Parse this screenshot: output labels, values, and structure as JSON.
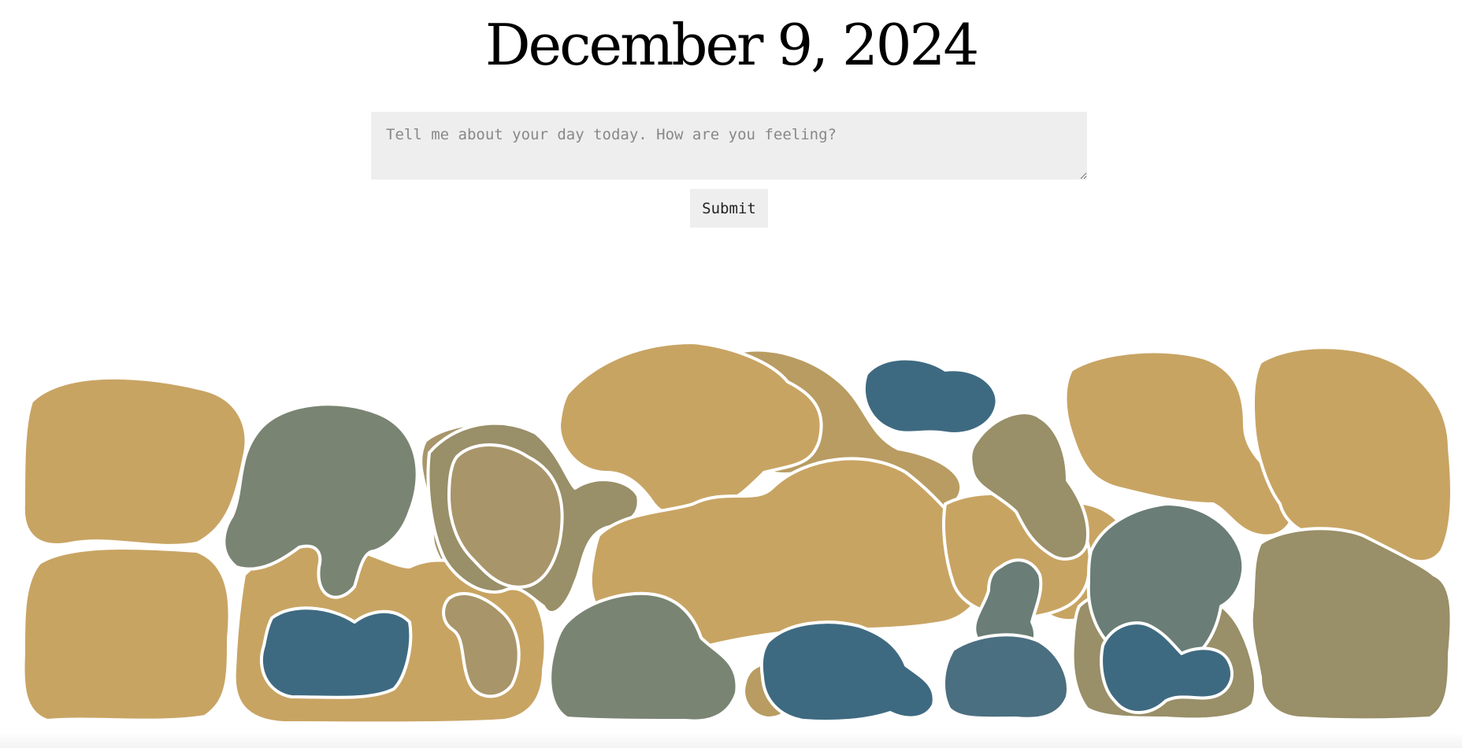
{
  "header": {
    "date": "December 9, 2024"
  },
  "journal": {
    "placeholder": "Tell me about your day today. How are you feeling?",
    "value": "",
    "submit_label": "Submit"
  },
  "mood_blobs": {
    "palette": {
      "gold": "#c8a463",
      "tan": "#b89c62",
      "olive": "#998f68",
      "khaki": "#a8956a",
      "sage": "#7a8473",
      "slate-green": "#6a7d76",
      "teal-blue": "#3e6a81",
      "steel-blue": "#4a6f80"
    },
    "entries": [
      {
        "color": "gold"
      },
      {
        "color": "gold"
      },
      {
        "color": "sage"
      },
      {
        "color": "gold"
      },
      {
        "color": "teal-blue"
      },
      {
        "color": "olive"
      },
      {
        "color": "khaki"
      },
      {
        "color": "gold"
      },
      {
        "color": "tan"
      },
      {
        "color": "gold"
      },
      {
        "color": "sage"
      },
      {
        "color": "teal-blue"
      },
      {
        "color": "teal-blue"
      },
      {
        "color": "olive"
      },
      {
        "color": "gold"
      },
      {
        "color": "slate-green"
      },
      {
        "color": "teal-blue"
      },
      {
        "color": "gold"
      },
      {
        "color": "gold"
      },
      {
        "color": "olive"
      },
      {
        "color": "slate-green"
      },
      {
        "color": "steel-blue"
      }
    ]
  }
}
